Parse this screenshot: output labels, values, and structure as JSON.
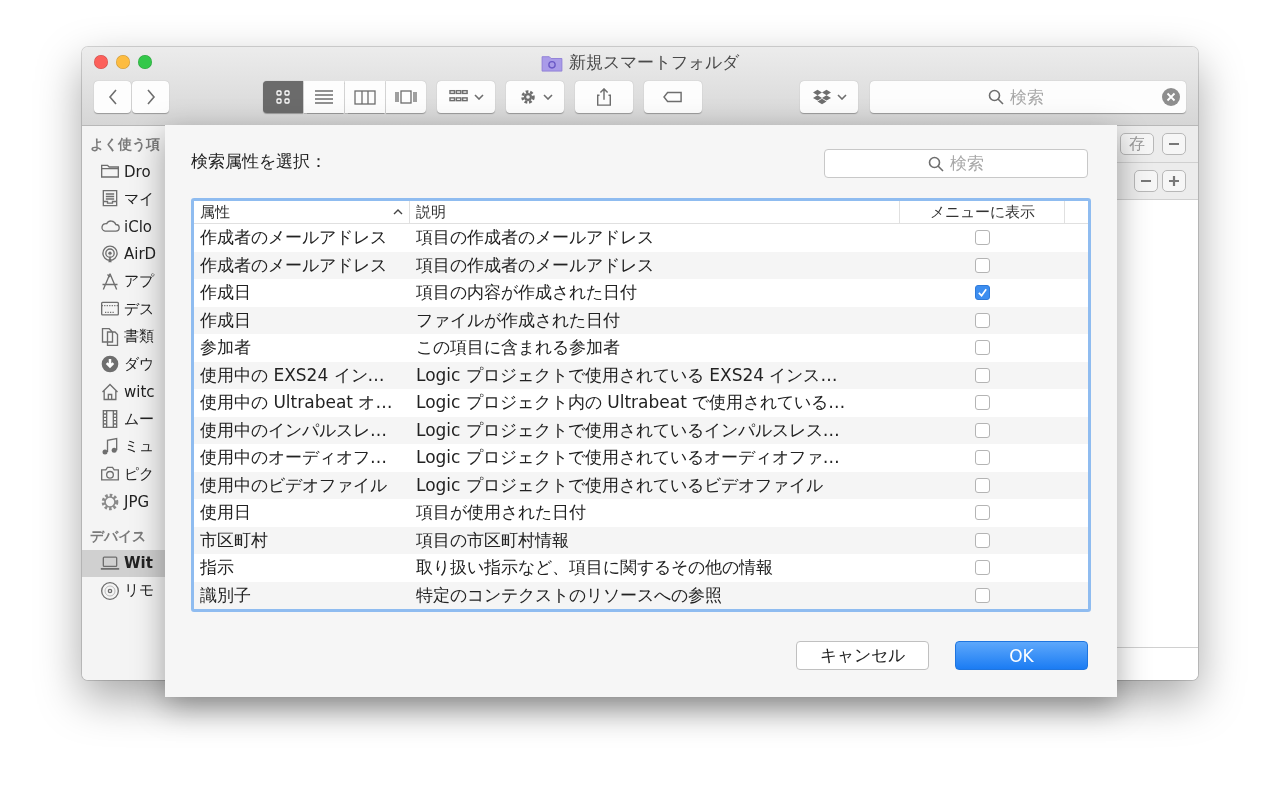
{
  "window": {
    "title": "新規スマートフォルダ"
  },
  "toolbar": {
    "view_modes": [
      {
        "selected": true
      },
      {
        "selected": false
      },
      {
        "selected": false
      },
      {
        "selected": false
      }
    ],
    "search": {
      "placeholder": "検索"
    }
  },
  "sidebar": {
    "sections": [
      {
        "label": "よく使う項",
        "items": [
          {
            "label": "Dro",
            "selected": false
          },
          {
            "label": "マイ",
            "selected": false
          },
          {
            "label": "iClo",
            "selected": false
          },
          {
            "label": "AirD",
            "selected": false
          },
          {
            "label": "アプ",
            "selected": false
          },
          {
            "label": "デス",
            "selected": false
          },
          {
            "label": "書類",
            "selected": false
          },
          {
            "label": "ダウ",
            "selected": false
          },
          {
            "label": "witc",
            "selected": false
          },
          {
            "label": "ムー",
            "selected": false
          },
          {
            "label": "ミュ",
            "selected": false
          },
          {
            "label": "ピク",
            "selected": false
          },
          {
            "label": "JPG",
            "selected": false
          }
        ]
      },
      {
        "label": "デバイス",
        "items": [
          {
            "label": "Wit",
            "selected": true
          },
          {
            "label": "リモ",
            "selected": false
          }
        ]
      }
    ]
  },
  "search_bar": {
    "save_button": "存"
  },
  "sheet": {
    "title": "検索属性を選択：",
    "search": {
      "placeholder": "検索"
    },
    "table": {
      "columns": [
        "属性",
        "説明",
        "メニューに表示"
      ],
      "rows": [
        {
          "attribute": "作成者のメールアドレス",
          "description": "項目の作成者のメールアドレス",
          "checked": false
        },
        {
          "attribute": "作成者のメールアドレス",
          "description": "項目の作成者のメールアドレス",
          "checked": false
        },
        {
          "attribute": "作成日",
          "description": "項目の内容が作成された日付",
          "checked": true
        },
        {
          "attribute": "作成日",
          "description": "ファイルが作成された日付",
          "checked": false
        },
        {
          "attribute": "参加者",
          "description": "この項目に含まれる参加者",
          "checked": false
        },
        {
          "attribute": "使用中の EXS24 イン…",
          "description": "Logic プロジェクトで使用されている EXS24 インス…",
          "checked": false
        },
        {
          "attribute": "使用中の Ultrabeat オ…",
          "description": "Logic プロジェクト内の Ultrabeat で使用されている…",
          "checked": false
        },
        {
          "attribute": "使用中のインパルスレ…",
          "description": "Logic プロジェクトで使用されているインパルスレス…",
          "checked": false
        },
        {
          "attribute": "使用中のオーディオフ…",
          "description": "Logic プロジェクトで使用されているオーディオファ…",
          "checked": false
        },
        {
          "attribute": "使用中のビデオファイル",
          "description": "Logic プロジェクトで使用されているビデオファイル",
          "checked": false
        },
        {
          "attribute": "使用日",
          "description": "項目が使用された日付",
          "checked": false
        },
        {
          "attribute": "市区町村",
          "description": "項目の市区町村情報",
          "checked": false
        },
        {
          "attribute": "指示",
          "description": "取り扱い指示など、項目に関するその他の情報",
          "checked": false
        },
        {
          "attribute": "識別子",
          "description": "特定のコンテクストのリソースへの参照",
          "checked": false
        }
      ]
    },
    "buttons": [
      {
        "label": "キャンセル",
        "kind": "secondary"
      },
      {
        "label": "OK",
        "kind": "primary"
      }
    ]
  }
}
